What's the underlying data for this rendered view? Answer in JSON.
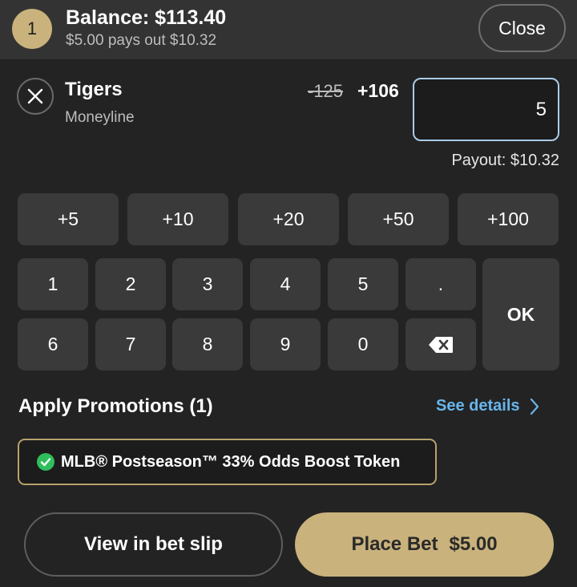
{
  "header": {
    "bet_count": "1",
    "balance": "Balance: $113.40",
    "pays_out": "$5.00 pays out $10.32",
    "close_label": "Close"
  },
  "selection": {
    "team": "Tigers",
    "market": "Moneyline",
    "odds_old": "-125",
    "odds_new": "+106",
    "wager_value": "5",
    "payout": "Payout: $10.32"
  },
  "quick_add": [
    "+5",
    "+10",
    "+20",
    "+50",
    "+100"
  ],
  "keypad": {
    "row1": [
      "1",
      "2",
      "3",
      "4",
      "5",
      "."
    ],
    "row2": [
      "6",
      "7",
      "8",
      "9",
      "0"
    ],
    "ok_label": "OK"
  },
  "promotions": {
    "title": "Apply Promotions (1)",
    "see_details": "See details",
    "token_label": "MLB® Postseason™ 33% Odds Boost Token"
  },
  "actions": {
    "view_slip_label": "View in bet slip",
    "place_bet_label": "Place Bet",
    "place_bet_amount": "$5.00"
  },
  "colors": {
    "background": "#232323",
    "header": "#333333",
    "gold": "#c9b27c",
    "link_blue": "#68b5ec",
    "input_border": "#a9cbe8",
    "check_green": "#2fbe5b"
  }
}
